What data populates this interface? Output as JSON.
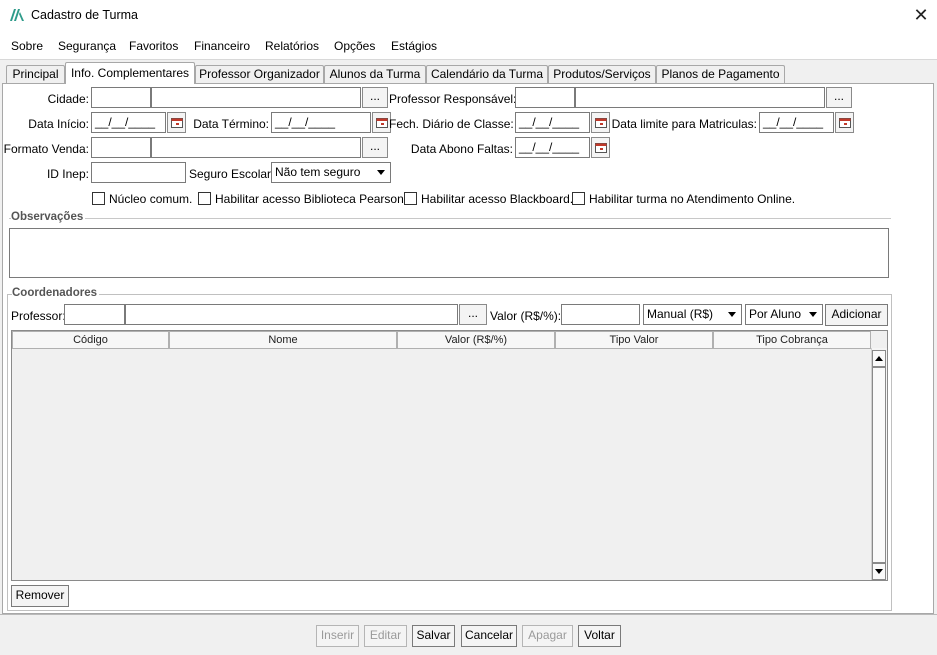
{
  "window": {
    "title": "Cadastro de Turma"
  },
  "menu": [
    "Sobre",
    "Segurança",
    "Favoritos",
    "Financeiro",
    "Relatórios",
    "Opções",
    "Estágios"
  ],
  "tabs": [
    "Principal",
    "Info. Complementares",
    "Professor Organizador",
    "Alunos da Turma",
    "Calendário da Turma",
    "Produtos/Serviços",
    "Planos de Pagamento"
  ],
  "active_tab": "Info. Complementares",
  "form": {
    "cidade_label": "Cidade:",
    "prof_resp_label": "Professor Responsável:",
    "data_inicio_label": "Data Início:",
    "data_inicio_value": "__/__/____",
    "data_termino_label": "Data Término:",
    "data_termino_value": "__/__/____",
    "fech_diario_label": "Fech. Diário de Classe:",
    "fech_diario_value": "__/__/____",
    "data_limite_label": "Data limite para Matriculas:",
    "data_limite_value": "__/__/____",
    "formato_venda_label": "Formato Venda:",
    "data_abono_label": "Data Abono Faltas:",
    "data_abono_value": "__/__/____",
    "id_inep_label": "ID Inep:",
    "seguro_label": "Seguro Escolar:",
    "seguro_value": "Não tem seguro",
    "ellipsis": "..."
  },
  "checkboxes": [
    {
      "label": "Núcleo comum.",
      "checked": false
    },
    {
      "label": "Habilitar acesso Biblioteca Pearson.",
      "checked": false
    },
    {
      "label": "Habilitar acesso Blackboard.",
      "checked": false
    },
    {
      "label": "Habilitar turma no Atendimento Online.",
      "checked": false
    }
  ],
  "observacoes": {
    "title": "Observações"
  },
  "coordenadores": {
    "title": "Coordenadores",
    "professor_label": "Professor:",
    "valor_label": "Valor (R$/%):",
    "tipo_valor": "Manual (R$)",
    "tipo_cobranca": "Por Aluno",
    "adicionar": "Adicionar",
    "remover": "Remover",
    "columns": [
      "Código",
      "Nome",
      "Valor (R$/%)",
      "Tipo Valor",
      "Tipo Cobrança"
    ]
  },
  "footer_buttons": [
    {
      "label": "Inserir",
      "enabled": false
    },
    {
      "label": "Editar",
      "enabled": false
    },
    {
      "label": "Salvar",
      "enabled": true
    },
    {
      "label": "Cancelar",
      "enabled": true
    },
    {
      "label": "Apagar",
      "enabled": false
    },
    {
      "label": "Voltar",
      "enabled": true
    }
  ],
  "colors": {
    "accent": "#2e9b8a",
    "panel_border": "#a8a8a8",
    "disabled_text": "#9a9a9a"
  }
}
